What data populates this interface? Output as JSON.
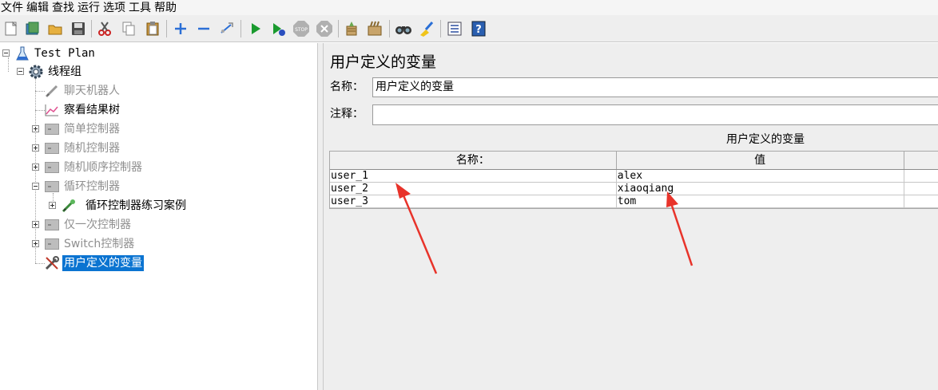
{
  "menu": [
    "文件",
    "编辑",
    "查找",
    "运行",
    "选项",
    "工具",
    "帮助"
  ],
  "toolbar": {
    "icons": [
      "new-icon",
      "templates-icon",
      "open-icon",
      "save-icon",
      "cut-icon",
      "copy-icon",
      "paste-icon",
      "expand-icon",
      "collapse-icon",
      "toggle-icon",
      "start-icon",
      "start-no-pause-icon",
      "stop-icon",
      "shutdown-icon",
      "clear-icon",
      "clear-all-icon",
      "search-icon",
      "reset-search-icon",
      "function-helper-icon",
      "help-icon"
    ]
  },
  "tree": {
    "test_plan": "Test Plan",
    "thread_group": "线程组",
    "items": [
      {
        "label": "聊天机器人",
        "disabled": true
      },
      {
        "label": "察看结果树",
        "disabled": false
      },
      {
        "label": "简单控制器",
        "disabled": true
      },
      {
        "label": "随机控制器",
        "disabled": true
      },
      {
        "label": "随机顺序控制器",
        "disabled": true
      },
      {
        "label": "循环控制器",
        "disabled": true
      },
      {
        "label": "循环控制器练习案例",
        "disabled": false
      },
      {
        "label": "仅一次控制器",
        "disabled": true
      },
      {
        "label": "Switch控制器",
        "disabled": true
      },
      {
        "label": "用户定义的变量",
        "disabled": false,
        "selected": true
      }
    ]
  },
  "panel": {
    "title": "用户定义的变量",
    "name_label": "名称：",
    "name_value": "用户定义的变量",
    "comment_label": "注释：",
    "comment_value": "",
    "table_caption": "用户定义的变量",
    "columns": [
      "名称：",
      "值",
      ""
    ],
    "rows": [
      [
        "user_1",
        "alex",
        ""
      ],
      [
        "user_2",
        "xiaoqiang",
        ""
      ],
      [
        "user_3",
        "tom",
        ""
      ]
    ]
  },
  "colors": {
    "selection": "#0b74d1",
    "annotation_arrow": "#e8332a",
    "start_green": "#1a9a2e"
  }
}
